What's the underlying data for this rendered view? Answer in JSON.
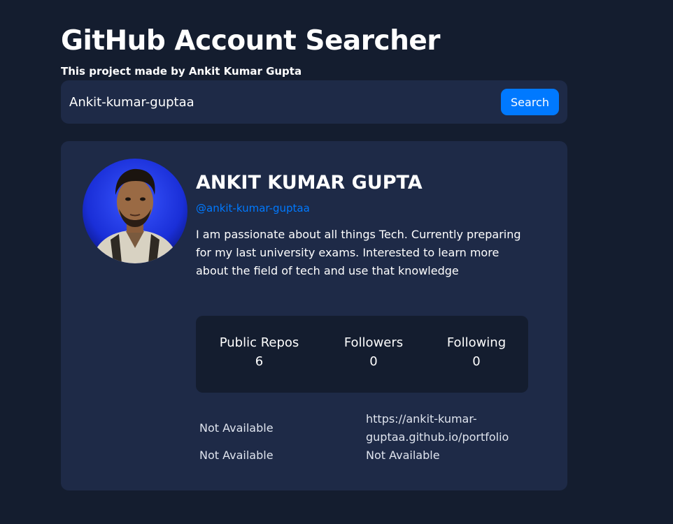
{
  "header": {
    "title": "GitHub Account Searcher",
    "subtitle": "This project made by Ankit Kumar Gupta"
  },
  "search": {
    "value": "Ankit-kumar-guptaa",
    "button_label": "Search"
  },
  "profile": {
    "name": "ANKIT KUMAR GUPTA",
    "login": "@ankit-kumar-guptaa",
    "bio": "I am passionate about all things Tech. Currently preparing for my last university exams. Interested to learn more about the field of tech and use that knowledge",
    "stats": [
      {
        "label": "Public Repos",
        "value": "6"
      },
      {
        "label": "Followers",
        "value": "0"
      },
      {
        "label": "Following",
        "value": "0"
      }
    ],
    "links": {
      "location": "Not Available",
      "website": "https://ankit-kumar-guptaa.github.io/portfolio",
      "twitter": "Not Available",
      "company": "Not Available"
    }
  },
  "colors": {
    "background": "#141d2f",
    "card": "#1e2a47",
    "accent": "#0079ff",
    "text": "#ffffff"
  }
}
